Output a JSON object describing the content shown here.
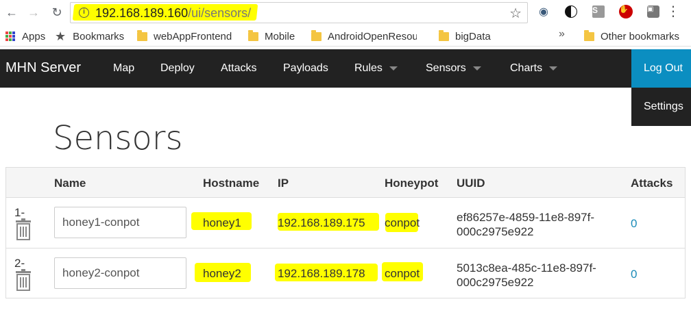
{
  "browser": {
    "url_host": "192.168.189.160",
    "url_path": "/ui/sensors/",
    "back_icon": "arrow-left-icon",
    "forward_icon": "arrow-right-icon",
    "reload_icon": "reload-icon",
    "highlight_color": "#ffff00"
  },
  "bookmarks": {
    "items": [
      {
        "label": "Apps"
      },
      {
        "label": "Bookmarks"
      },
      {
        "label": "webAppFrontend"
      },
      {
        "label": "Mobile"
      },
      {
        "label": "AndroidOpenResourc"
      },
      {
        "label": "bigData"
      }
    ],
    "overflow": "»",
    "other": "Other bookmarks"
  },
  "navbar": {
    "brand": "MHN Server",
    "items": [
      {
        "label": "Map"
      },
      {
        "label": "Deploy"
      },
      {
        "label": "Attacks"
      },
      {
        "label": "Payloads"
      },
      {
        "label": "Rules"
      },
      {
        "label": "Sensors"
      },
      {
        "label": "Charts"
      }
    ],
    "logout": "Log Out",
    "settings": "Settings",
    "bg_color": "#222222",
    "accent_color": "#0b8ec1"
  },
  "page": {
    "title": "Sensors"
  },
  "table": {
    "headers": [
      "Name",
      "Hostname",
      "IP",
      "Honeypot",
      "UUID",
      "Attacks"
    ],
    "rows": [
      {
        "index": "1-",
        "name": "honey1-conpot",
        "hostname": "honey1",
        "ip": "192.168.189.175",
        "honeypot": "conpot",
        "uuid_line1": "ef86257e-4859-11e8-897f-",
        "uuid_line2": "000c2975e922",
        "attacks": "0"
      },
      {
        "index": "2-",
        "name": "honey2-conpot",
        "hostname": "honey2",
        "ip": "192.168.189.178",
        "honeypot": "conpot",
        "uuid_line1": "5013c8ea-485c-11e8-897f-",
        "uuid_line2": "000c2975e922",
        "attacks": "0"
      }
    ]
  }
}
